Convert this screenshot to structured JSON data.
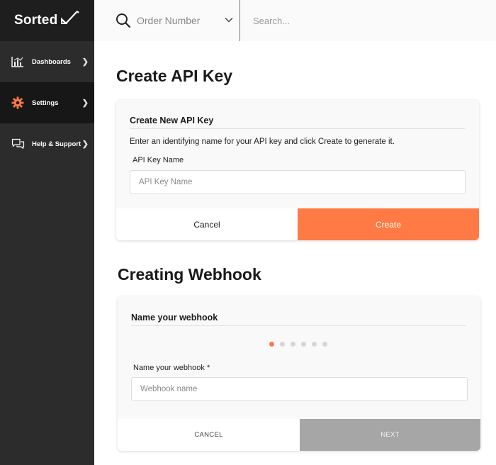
{
  "sidebar": {
    "logo": "Sorted",
    "items": [
      {
        "label": "Dashboards",
        "icon": "bar-chart-icon"
      },
      {
        "label": "Settings",
        "icon": "gear-icon",
        "active": true
      },
      {
        "label": "Help & Support",
        "icon": "chat-bubbles-icon"
      }
    ]
  },
  "topbar": {
    "order_select_label": "Order Number",
    "search_placeholder": "Search..."
  },
  "api_key": {
    "section_title": "Create API Key",
    "card_title": "Create New API Key",
    "description": "Enter an identifying name for your API key and click Create to generate it.",
    "field_label": "API Key Name",
    "field_placeholder": "API Key Name",
    "cancel_label": "Cancel",
    "create_label": "Create"
  },
  "webhook": {
    "section_title": "Creating Webhook",
    "card_title": "Name your webhook",
    "field_label": "Name your webhook *",
    "field_placeholder": "Webhook name",
    "cancel_label": "CANCEL",
    "next_label": "NEXT",
    "steps_total": 6,
    "current_step": 1
  },
  "colors": {
    "accent": "#ff7a45",
    "sidebar_bg": "#2c2c2c",
    "sidebar_active": "#171717",
    "disabled_button": "#a6a6a6"
  }
}
